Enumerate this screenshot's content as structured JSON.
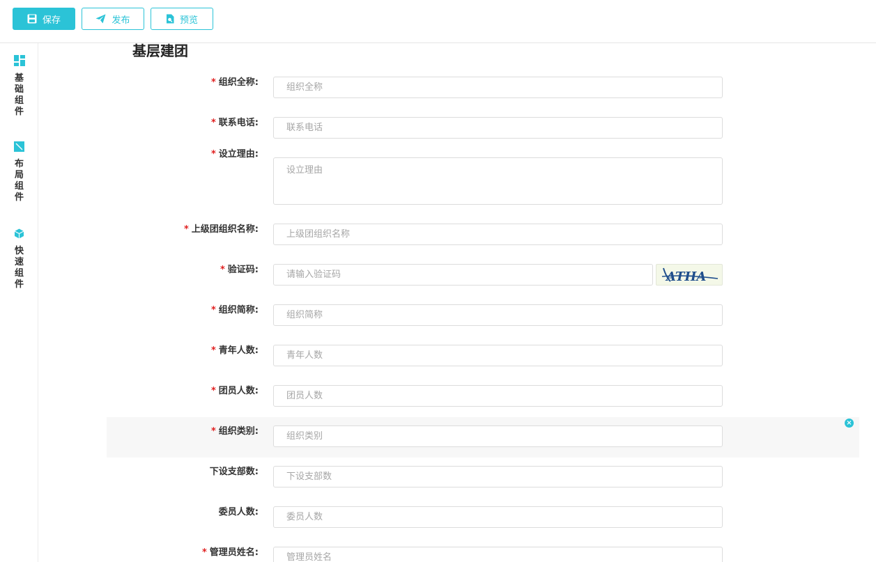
{
  "toolbar": {
    "save_label": "保存",
    "publish_label": "发布",
    "preview_label": "预览"
  },
  "sidebar": {
    "items": [
      {
        "label": "基础组件",
        "icon": "grid-icon"
      },
      {
        "label": "布局组件",
        "icon": "layout-icon"
      },
      {
        "label": "快速组件",
        "icon": "cube-icon"
      }
    ]
  },
  "form": {
    "title": "基层建团",
    "fields": [
      {
        "label": "组织全称:",
        "required": true,
        "placeholder": "组织全称"
      },
      {
        "label": "联系电话:",
        "required": true,
        "placeholder": "联系电话"
      },
      {
        "label": "设立理由:",
        "required": true,
        "placeholder": "设立理由"
      },
      {
        "label": "上级团组织名称:",
        "required": true,
        "placeholder": "上级团组织名称"
      },
      {
        "label": "验证码:",
        "required": true,
        "placeholder": "请输入验证码",
        "captcha_text": "ATHA"
      },
      {
        "label": "组织简称:",
        "required": true,
        "placeholder": "组织简称"
      },
      {
        "label": "青年人数:",
        "required": true,
        "placeholder": "青年人数"
      },
      {
        "label": "团员人数:",
        "required": true,
        "placeholder": "团员人数"
      },
      {
        "label": "组织类别:",
        "required": true,
        "placeholder": "组织类别"
      },
      {
        "label": "下设支部数:",
        "required": false,
        "placeholder": "下设支部数"
      },
      {
        "label": "委员人数:",
        "required": false,
        "placeholder": "委员人数"
      },
      {
        "label": "管理员姓名:",
        "required": true,
        "placeholder": "管理员姓名"
      }
    ],
    "required_mark": "*",
    "close_glyph": "×"
  },
  "colors": {
    "accent": "#2bc3d7",
    "required": "#e02020",
    "highlight_row": "#f7f7f7"
  }
}
